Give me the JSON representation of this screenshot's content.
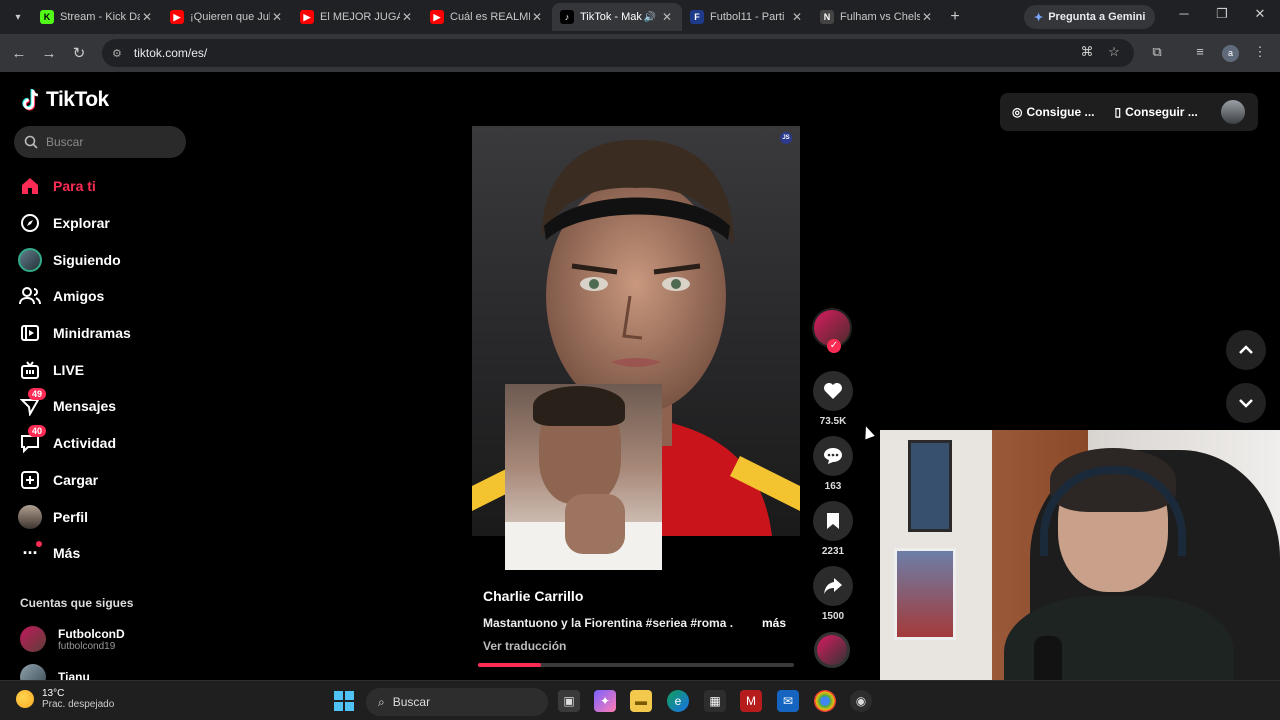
{
  "browser": {
    "tabs": [
      {
        "label": "Stream - Kick Da",
        "favicon": "kick-icon",
        "color": "#53fc18"
      },
      {
        "label": "¡Quieren que Jul",
        "favicon": "youtube-icon",
        "color": "#ff0000"
      },
      {
        "label": "El MEJOR JUGAD",
        "favicon": "youtube-icon",
        "color": "#ff0000"
      },
      {
        "label": "Cuál es REALME",
        "favicon": "youtube-icon",
        "color": "#ff0000"
      },
      {
        "label": "TikTok - Mak",
        "favicon": "tiktok-icon",
        "color": "#000000",
        "active": true
      },
      {
        "label": "Futbol11 - Parti",
        "favicon": "futbol11-icon",
        "color": "#1e3a8a"
      },
      {
        "label": "Fulham vs Chels",
        "favicon": "nbc-icon",
        "color": "#444444"
      }
    ],
    "gemini_label": "Pregunta a Gemini",
    "url": "tiktok.com/es/",
    "profile_initial": "a"
  },
  "tiktok": {
    "logo": "TikTok",
    "search_placeholder": "Buscar",
    "nav": [
      {
        "label": "Para ti",
        "icon": "home-icon",
        "active": true
      },
      {
        "label": "Explorar",
        "icon": "compass-icon"
      },
      {
        "label": "Siguiendo",
        "icon": "following-avatar-icon"
      },
      {
        "label": "Amigos",
        "icon": "friends-icon"
      },
      {
        "label": "Minidramas",
        "icon": "minidramas-icon"
      },
      {
        "label": "LIVE",
        "icon": "live-icon"
      },
      {
        "label": "Mensajes",
        "icon": "messages-icon",
        "badge": "49"
      },
      {
        "label": "Actividad",
        "icon": "activity-icon",
        "badge": "40"
      },
      {
        "label": "Cargar",
        "icon": "upload-icon"
      },
      {
        "label": "Perfil",
        "icon": "profile-avatar-icon"
      },
      {
        "label": "Más",
        "icon": "more-icon",
        "dot": true
      }
    ],
    "following_title": "Cuentas que sigues",
    "following": [
      {
        "name": "FutbolconD",
        "handle": "futbolcond19"
      },
      {
        "name": "Tianu",
        "handle": ""
      }
    ],
    "top_buttons": {
      "coins": "Consigue ...",
      "app": "Conseguir ..."
    },
    "video": {
      "author": "Charlie Carrillo",
      "caption": "Mastantuono y la Fiorentina #seriea #roma ...",
      "more": "más",
      "translate": "Ver traducción",
      "progress": 0.2,
      "likes": "73.5K",
      "comments": "163",
      "saves": "2231",
      "shares": "1500",
      "watermark": "JS"
    },
    "accent": "#fe2c55"
  },
  "taskbar": {
    "temp": "13°C",
    "weather": "Prac. despejado",
    "search": "Buscar"
  }
}
